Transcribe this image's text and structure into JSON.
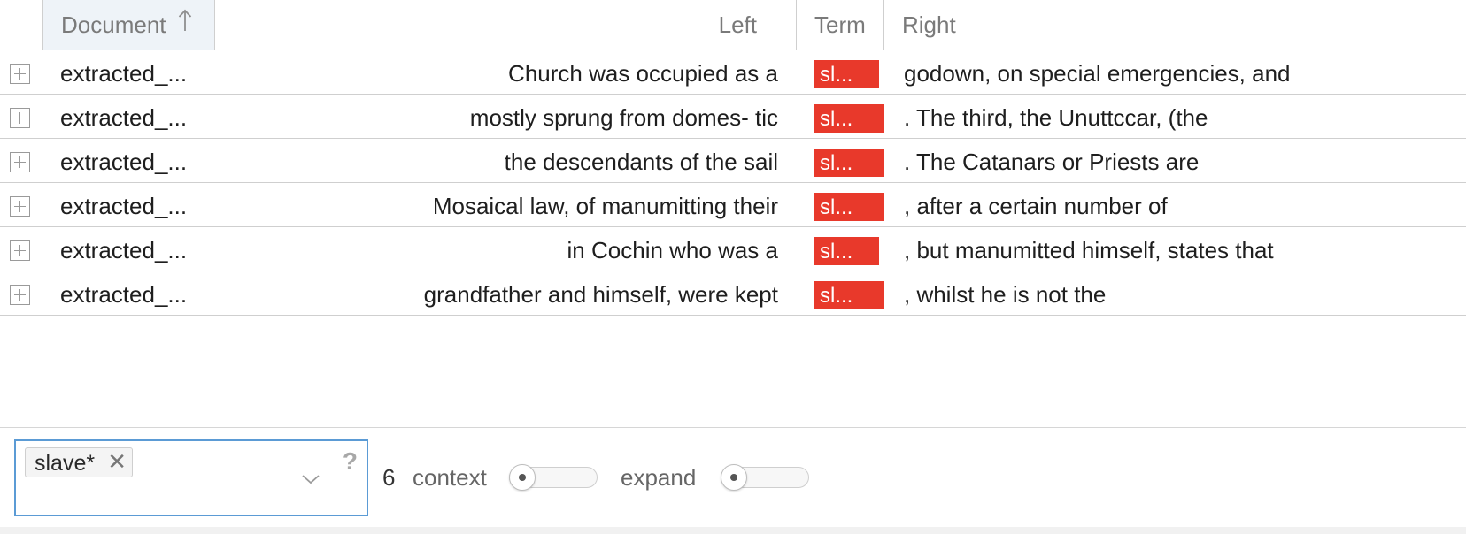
{
  "columns": {
    "document": "Document",
    "left": "Left",
    "term": "Term",
    "right": "Right"
  },
  "rows": [
    {
      "document": "extracted_...",
      "left": "Church was occupied as a",
      "term": "sl...",
      "right": "godown, on special emergencies, and"
    },
    {
      "document": "extracted_...",
      "left": "mostly sprung from domes- tic",
      "term": "sl...",
      "right": ". The third, the Unuttccar, (the"
    },
    {
      "document": "extracted_...",
      "left": "the descendants of the sail",
      "term": "sl...",
      "right": ". The Catanars or Priests are"
    },
    {
      "document": "extracted_...",
      "left": "Mosaical law, of manumitting their",
      "term": "sl...",
      "right": ", after a certain number of"
    },
    {
      "document": "extracted_...",
      "left": "in Cochin who was a",
      "term": "sl...",
      "right": ", but manumitted himself, states that"
    },
    {
      "document": "extracted_...",
      "left": "grandfather and himself, were kept",
      "term": "sl...",
      "right": ", whilst he is not the"
    }
  ],
  "footer": {
    "query_tag": "slave*",
    "help": "?",
    "context_value": "6",
    "context_label": "context",
    "expand_label": "expand"
  },
  "colors": {
    "term_highlight": "#e8392b",
    "header_sorted_bg": "#eef3f8",
    "focus_border": "#5b9bd5"
  },
  "icons": {
    "sort": "arrow-up-icon",
    "expander": "plus-square-icon",
    "remove_tag": "close-icon",
    "dropdown": "chevron-down-icon",
    "help": "question-icon"
  }
}
